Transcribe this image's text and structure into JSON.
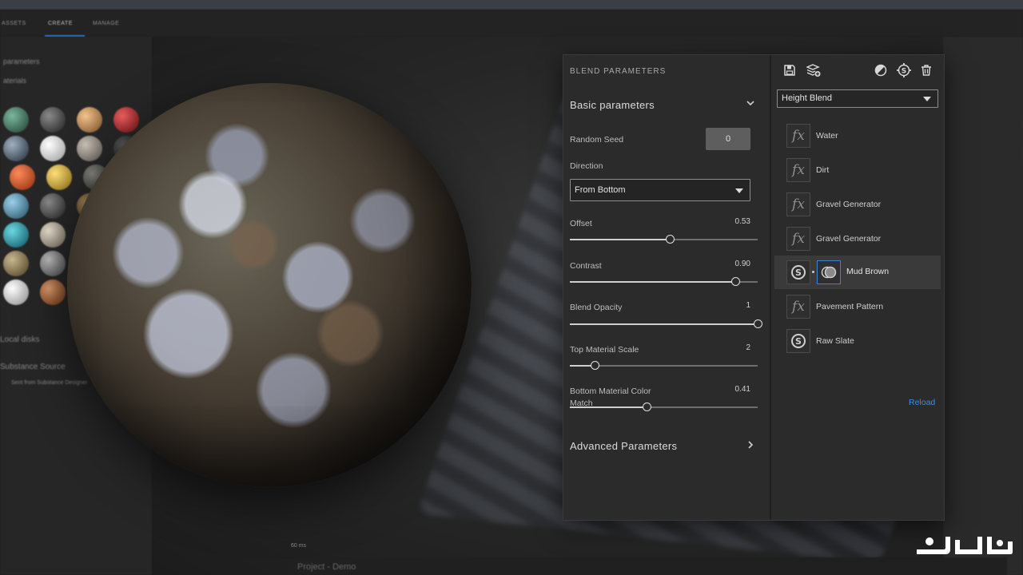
{
  "background": {
    "tabs": [
      "ASSETS",
      "CREATE",
      "MANAGE"
    ],
    "left_labels": [
      "parameters",
      "aterials",
      "Local disks",
      "Substance Source",
      "Sent from Substance Designer"
    ],
    "footer_project": "Project - Demo",
    "fps": "60 ms"
  },
  "blend_panel": {
    "title": "BLEND PARAMETERS",
    "basic_section": "Basic parameters",
    "random_seed": {
      "label": "Random Seed",
      "value": "0"
    },
    "direction": {
      "label": "Direction",
      "value": "From Bottom"
    },
    "sliders": [
      {
        "label": "Offset",
        "value": "0.53",
        "fraction": 0.53
      },
      {
        "label": "Contrast",
        "value": "0.90",
        "fraction": 0.88
      },
      {
        "label": "Blend Opacity",
        "value": "1",
        "fraction": 1.0
      },
      {
        "label": "Top Material Scale",
        "value": "2",
        "fraction": 0.13
      },
      {
        "label": "Bottom Material Color",
        "value": "0.41",
        "fraction": 0.41,
        "sub_label": "Match"
      }
    ],
    "advanced_section": "Advanced Parameters"
  },
  "layers_panel": {
    "blend_mode": "Height Blend",
    "icons": [
      "save-icon",
      "add-layer-icon",
      "mask-icon",
      "substance-settings-icon",
      "trash-icon"
    ],
    "layers": [
      {
        "name": "Water",
        "type": "fx"
      },
      {
        "name": "Dirt",
        "type": "fx"
      },
      {
        "name": "Gravel Generator",
        "type": "fx"
      },
      {
        "name": "Gravel Generator",
        "type": "fx"
      },
      {
        "name": "Mud Brown",
        "type": "substance",
        "selected": true
      },
      {
        "name": "Pavement Pattern",
        "type": "fx"
      },
      {
        "name": "Raw Slate",
        "type": "substance"
      }
    ],
    "reload": "Reload"
  },
  "colors": {
    "accent": "#3a8ee8",
    "panel": "#2b2b2b"
  }
}
